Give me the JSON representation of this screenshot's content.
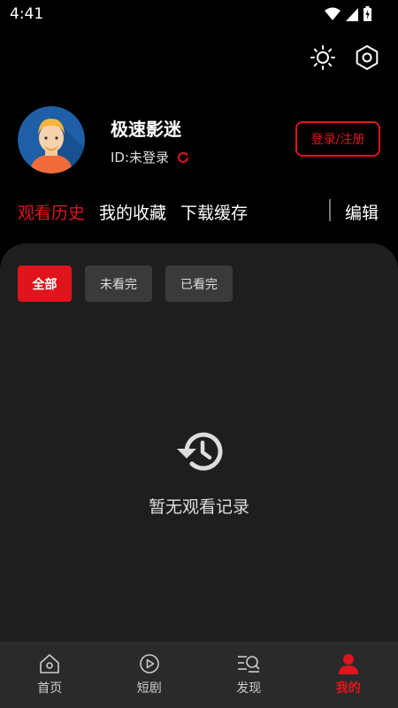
{
  "status_bar": {
    "time": "4:41"
  },
  "profile": {
    "username": "极速影迷",
    "user_id": "ID:未登录",
    "login_label": "登录/注册"
  },
  "tabs": [
    {
      "label": "观看历史",
      "active": true
    },
    {
      "label": "我的收藏",
      "active": false
    },
    {
      "label": "下载缓存",
      "active": false
    }
  ],
  "edit_label": "编辑",
  "filters": [
    {
      "label": "全部",
      "active": true
    },
    {
      "label": "未看完",
      "active": false
    },
    {
      "label": "已看完",
      "active": false
    }
  ],
  "empty_state": {
    "text": "暂无观看记录",
    "icon": "history-icon"
  },
  "bottom_nav": [
    {
      "label": "首页",
      "icon": "home-icon",
      "active": false
    },
    {
      "label": "短剧",
      "icon": "play-circle-icon",
      "active": false
    },
    {
      "label": "发现",
      "icon": "discover-icon",
      "active": false
    },
    {
      "label": "我的",
      "icon": "person-icon",
      "active": true
    }
  ],
  "colors": {
    "accent": "#e0141c",
    "panel": "#1e1e1e",
    "nav": "#2a2a2a"
  }
}
